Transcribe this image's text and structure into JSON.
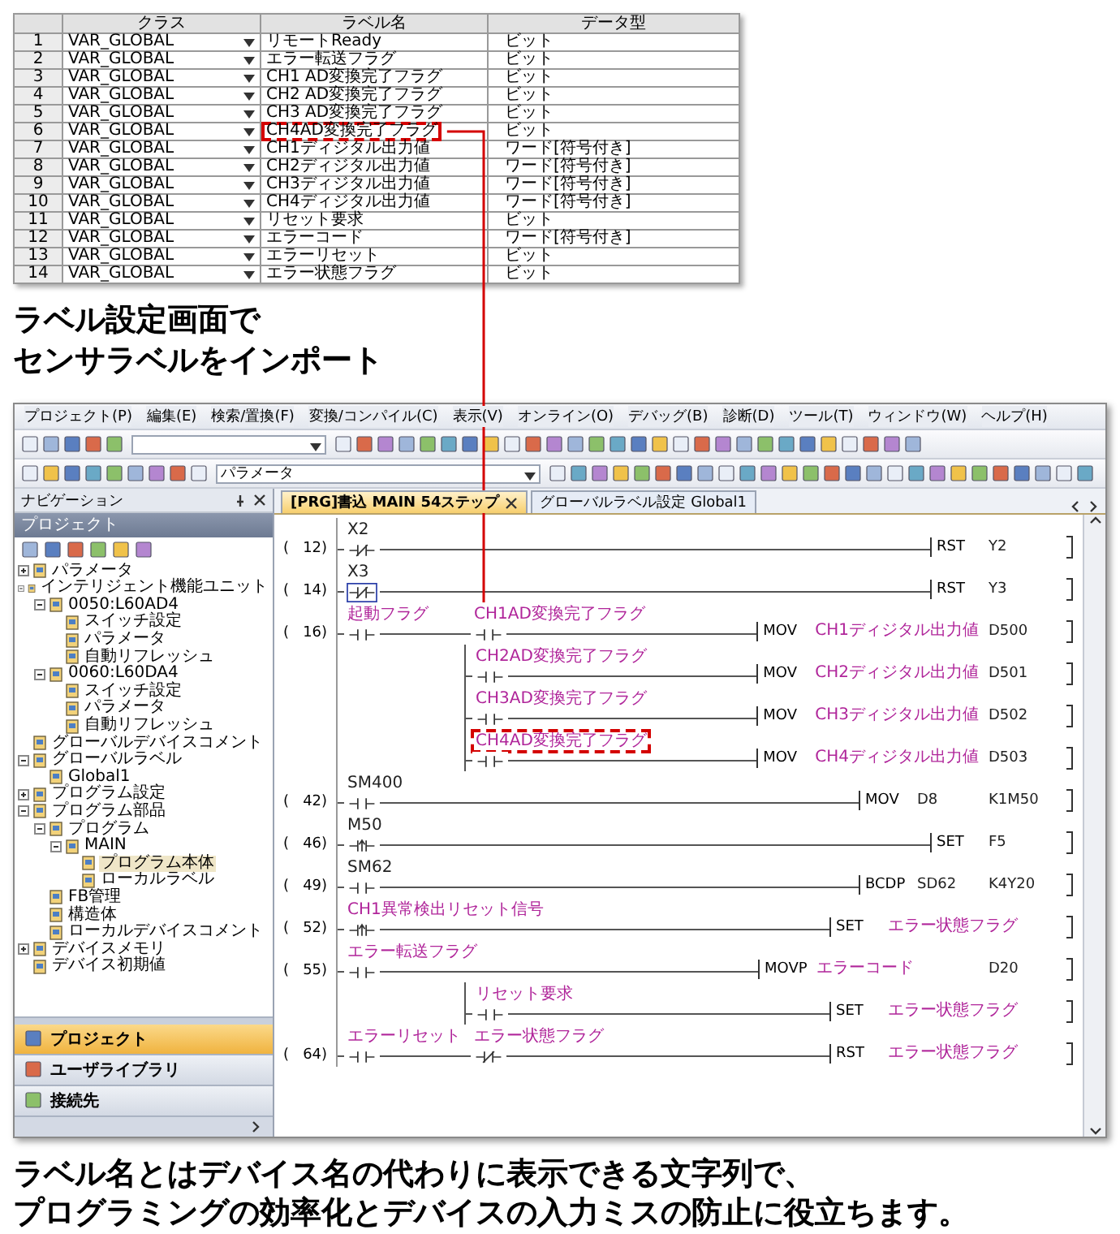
{
  "label_table": {
    "columns": [
      "クラス",
      "ラベル名",
      "データ型"
    ],
    "rows": [
      {
        "number": "1",
        "class": "VAR_GLOBAL",
        "label": "リモートReady",
        "data_type": "ビット",
        "highlighted": false
      },
      {
        "number": "2",
        "class": "VAR_GLOBAL",
        "label": "エラー転送フラグ",
        "data_type": "ビット",
        "highlighted": false
      },
      {
        "number": "3",
        "class": "VAR_GLOBAL",
        "label": "CH1 AD変換完了フラグ",
        "data_type": "ビット",
        "highlighted": false
      },
      {
        "number": "4",
        "class": "VAR_GLOBAL",
        "label": "CH2 AD変換完了フラグ",
        "data_type": "ビット",
        "highlighted": false
      },
      {
        "number": "5",
        "class": "VAR_GLOBAL",
        "label": "CH3 AD変換完了フラグ",
        "data_type": "ビット",
        "highlighted": false
      },
      {
        "number": "6",
        "class": "VAR_GLOBAL",
        "label": "CH4AD変換完了フラグ",
        "data_type": "ビット",
        "highlighted": true
      },
      {
        "number": "7",
        "class": "VAR_GLOBAL",
        "label": "CH1ディジタル出力値",
        "data_type": "ワード[符号付き]",
        "highlighted": false
      },
      {
        "number": "8",
        "class": "VAR_GLOBAL",
        "label": "CH2ディジタル出力値",
        "data_type": "ワード[符号付き]",
        "highlighted": false
      },
      {
        "number": "9",
        "class": "VAR_GLOBAL",
        "label": "CH3ディジタル出力値",
        "data_type": "ワード[符号付き]",
        "highlighted": false
      },
      {
        "number": "10",
        "class": "VAR_GLOBAL",
        "label": "CH4ディジタル出力値",
        "data_type": "ワード[符号付き]",
        "highlighted": false
      },
      {
        "number": "11",
        "class": "VAR_GLOBAL",
        "label": "リセット要求",
        "data_type": "ビット",
        "highlighted": false
      },
      {
        "number": "12",
        "class": "VAR_GLOBAL",
        "label": "エラーコード",
        "data_type": "ワード[符号付き]",
        "highlighted": false
      },
      {
        "number": "13",
        "class": "VAR_GLOBAL",
        "label": "エラーリセット",
        "data_type": "ビット",
        "highlighted": false
      },
      {
        "number": "14",
        "class": "VAR_GLOBAL",
        "label": "エラー状態フラグ",
        "data_type": "ビット",
        "highlighted": false
      }
    ]
  },
  "caption": [
    "ラベル設定画面で",
    "センサラベルをインポート"
  ],
  "ide": {
    "menu": [
      "プロジェクト(P)",
      "編集(E)",
      "検索/置換(F)",
      "変換/コンパイル(C)",
      "表示(V)",
      "オンライン(O)",
      "デバッグ(B)",
      "診断(D)",
      "ツール(T)",
      "ウィンドウ(W)",
      "ヘルプ(H)"
    ],
    "toolbar_combo": "パラメータ",
    "navigation": {
      "title": "ナビゲーション",
      "panel_title": "プロジェクト",
      "tree": [
        {
          "label": "パラメータ",
          "expanded": false,
          "selected": false
        },
        {
          "label": "インテリジェント機能ユニット",
          "expanded": true,
          "selected": false,
          "children": [
            {
              "label": "0050:L60AD4",
              "expanded": true,
              "selected": false,
              "children": [
                {
                  "label": "スイッチ設定",
                  "selected": false
                },
                {
                  "label": "パラメータ",
                  "selected": false
                },
                {
                  "label": "自動リフレッシュ",
                  "selected": false
                }
              ]
            },
            {
              "label": "0060:L60DA4",
              "expanded": true,
              "selected": false,
              "children": [
                {
                  "label": "スイッチ設定",
                  "selected": false
                },
                {
                  "label": "パラメータ",
                  "selected": false
                },
                {
                  "label": "自動リフレッシュ",
                  "selected": false
                }
              ]
            }
          ]
        },
        {
          "label": "グローバルデバイスコメント",
          "selected": false
        },
        {
          "label": "グローバルラベル",
          "expanded": true,
          "selected": false,
          "children": [
            {
              "label": "Global1",
              "selected": false
            }
          ]
        },
        {
          "label": "プログラム設定",
          "expanded": false,
          "selected": false
        },
        {
          "label": "プログラム部品",
          "expanded": true,
          "selected": false,
          "children": [
            {
              "label": "プログラム",
              "expanded": true,
              "selected": false,
              "children": [
                {
                  "label": "MAIN",
                  "expanded": true,
                  "selected": false,
                  "children": [
                    {
                      "label": "プログラム本体",
                      "selected": true
                    },
                    {
                      "label": "ローカルラベル",
                      "selected": false
                    }
                  ]
                }
              ]
            },
            {
              "label": "FB管理",
              "selected": false
            },
            {
              "label": "構造体",
              "selected": false
            },
            {
              "label": "ローカルデバイスコメント",
              "selected": false
            }
          ]
        },
        {
          "label": "デバイスメモリ",
          "expanded": false,
          "selected": false
        },
        {
          "label": "デバイス初期値",
          "selected": false
        }
      ],
      "buttons": [
        {
          "label": "プロジェクト",
          "selected": true
        },
        {
          "label": "ユーザライブラリ",
          "selected": false
        },
        {
          "label": "接続先",
          "selected": false
        }
      ]
    },
    "tabs": [
      {
        "label": "[PRG]書込 MAIN 54ステップ",
        "selected": true
      },
      {
        "label": "グローバルラベル設定 Global1",
        "selected": false
      }
    ],
    "ladder": [
      {
        "step": "(   12)",
        "branch": false,
        "contacts": [
          {
            "text": "X2",
            "kind": "nc",
            "is_label": false,
            "selected": false,
            "highlighted": false
          }
        ],
        "op": "RST",
        "operands": [
          {
            "text": "Y2",
            "is_label": false
          }
        ]
      },
      {
        "step": "(   14)",
        "branch": false,
        "contacts": [
          {
            "text": "X3",
            "kind": "nc",
            "is_label": false,
            "selected": true,
            "highlighted": false
          }
        ],
        "op": "RST",
        "operands": [
          {
            "text": "Y3",
            "is_label": false
          }
        ]
      },
      {
        "step": "(   16)",
        "branch": false,
        "contacts": [
          {
            "text": "起動フラグ",
            "kind": "no",
            "is_label": true,
            "selected": false,
            "highlighted": false
          },
          {
            "text": "CH1AD変換完了フラグ",
            "kind": "no",
            "is_label": true,
            "selected": false,
            "highlighted": false
          }
        ],
        "op": "MOV",
        "operands": [
          {
            "text": "CH1ディジタル出力値",
            "is_label": true
          },
          {
            "text": "D500",
            "is_label": false
          }
        ]
      },
      {
        "branch": true,
        "contacts": [
          {
            "text": "CH2AD変換完了フラグ",
            "kind": "no",
            "is_label": true,
            "selected": false,
            "highlighted": false
          }
        ],
        "op": "MOV",
        "operands": [
          {
            "text": "CH2ディジタル出力値",
            "is_label": true
          },
          {
            "text": "D501",
            "is_label": false
          }
        ]
      },
      {
        "branch": true,
        "contacts": [
          {
            "text": "CH3AD変換完了フラグ",
            "kind": "no",
            "is_label": true,
            "selected": false,
            "highlighted": false
          }
        ],
        "op": "MOV",
        "operands": [
          {
            "text": "CH3ディジタル出力値",
            "is_label": true
          },
          {
            "text": "D502",
            "is_label": false
          }
        ]
      },
      {
        "branch": true,
        "contacts": [
          {
            "text": "CH4AD変換完了フラグ",
            "kind": "no",
            "is_label": true,
            "selected": false,
            "highlighted": true
          }
        ],
        "op": "MOV",
        "operands": [
          {
            "text": "CH4ディジタル出力値",
            "is_label": true
          },
          {
            "text": "D503",
            "is_label": false
          }
        ]
      },
      {
        "step": "(   42)",
        "branch": false,
        "contacts": [
          {
            "text": "SM400",
            "kind": "no",
            "is_label": false,
            "selected": false,
            "highlighted": false
          }
        ],
        "op": "MOV",
        "operands": [
          {
            "text": "D8",
            "is_label": false
          },
          {
            "text": "K1M50",
            "is_label": false
          }
        ]
      },
      {
        "step": "(   46)",
        "branch": false,
        "contacts": [
          {
            "text": "M50",
            "kind": "rise",
            "is_label": false,
            "selected": false,
            "highlighted": false
          }
        ],
        "op": "SET",
        "operands": [
          {
            "text": "F5",
            "is_label": false
          }
        ]
      },
      {
        "step": "(   49)",
        "branch": false,
        "contacts": [
          {
            "text": "SM62",
            "kind": "no",
            "is_label": false,
            "selected": false,
            "highlighted": false
          }
        ],
        "op": "BCDP",
        "operands": [
          {
            "text": "SD62",
            "is_label": false
          },
          {
            "text": "K4Y20",
            "is_label": false
          }
        ]
      },
      {
        "step": "(   52)",
        "branch": false,
        "contacts": [
          {
            "text": "CH1異常検出リセット信号",
            "kind": "rise",
            "is_label": true,
            "selected": false,
            "highlighted": false
          }
        ],
        "op": "SET",
        "operands": [
          {
            "text": "エラー状態フラグ",
            "is_label": true
          }
        ]
      },
      {
        "step": "(   55)",
        "branch": false,
        "contacts": [
          {
            "text": "エラー転送フラグ",
            "kind": "no",
            "is_label": true,
            "selected": false,
            "highlighted": false
          }
        ],
        "op": "MOVP",
        "operands": [
          {
            "text": "エラーコード",
            "is_label": true
          },
          {
            "text": "D20",
            "is_label": false
          }
        ]
      },
      {
        "branch": true,
        "contacts": [
          {
            "text": "リセット要求",
            "kind": "no",
            "is_label": true,
            "selected": false,
            "highlighted": false
          }
        ],
        "op": "SET",
        "operands": [
          {
            "text": "エラー状態フラグ",
            "is_label": true
          }
        ]
      },
      {
        "step": "(   64)",
        "branch": false,
        "contacts": [
          {
            "text": "エラーリセット",
            "kind": "no",
            "is_label": true,
            "selected": false,
            "highlighted": false
          },
          {
            "text": "エラー状態フラグ",
            "kind": "nc",
            "is_label": true,
            "selected": false,
            "highlighted": false
          }
        ],
        "op": "RST",
        "operands": [
          {
            "text": "エラー状態フラグ",
            "is_label": true
          }
        ]
      }
    ]
  },
  "description": [
    "ラベル名とはデバイス名の代わりに表示できる文字列で、",
    "プログラミングの効率化とデバイスの入力ミスの防止に役立ちます。"
  ]
}
